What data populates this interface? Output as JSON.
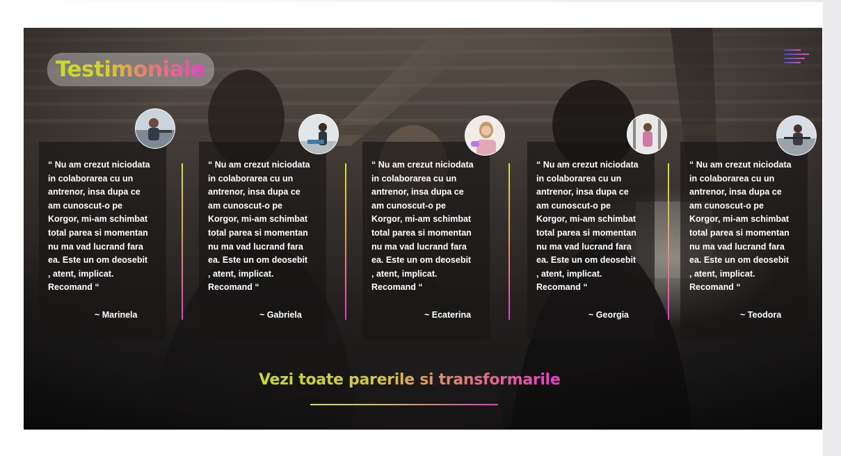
{
  "section": {
    "title": "Testimoniale",
    "menu_icon": "hamburger-menu-icon",
    "cta_label": "Vezi toate parerile si transformarile"
  },
  "colors": {
    "gradient_start": "#c7dc2a",
    "gradient_mid": "#e0a25c",
    "gradient_end": "#ec40c4",
    "card_background": "#181616",
    "menu_blue": "#3d4fd6",
    "menu_pink": "#e24bc8"
  },
  "testimonials": [
    {
      "text": "“ Nu am crezut niciodata\nin colaborarea cu un\nantrenor, insa dupa ce\nam cunoscut-o pe\n Korgor, mi-am schimbat\ntotal parea si momentan\nnu ma vad lucrand fara\nea. Este un om deosebit\n, atent, implicat.\nRecomand “",
      "author": "~ Marinela"
    },
    {
      "text": "“ Nu am crezut niciodata\nin colaborarea cu un\nantrenor, insa dupa ce\nam cunoscut-o pe\n Korgor, mi-am schimbat\ntotal parea si momentan\nnu ma vad lucrand fara\nea. Este un om deosebit\n, atent, implicat.\nRecomand “",
      "author": "~ Gabriela"
    },
    {
      "text": "“ Nu am crezut niciodata\nin colaborarea cu un\nantrenor, insa dupa ce\nam cunoscut-o pe\n Korgor, mi-am schimbat\ntotal parea si momentan\nnu ma vad lucrand fara\nea. Este un om deosebit\n, atent, implicat.\nRecomand “",
      "author": "~ Ecaterina"
    },
    {
      "text": "“ Nu am crezut niciodata\nin colaborarea cu un\nantrenor, insa dupa ce\nam cunoscut-o pe\n Korgor, mi-am schimbat\ntotal parea si momentan\nnu ma vad lucrand fara\nea. Este un om deosebit\n, atent, implicat.\nRecomand “",
      "author": "~ Georgia"
    },
    {
      "text": "“ Nu am crezut niciodata\nin colaborarea cu un\nantrenor, insa dupa ce\nam cunoscut-o pe\n Korgor, mi-am schimbat\ntotal parea si momentan\nnu ma vad lucrand fara\nea. Este un om deosebit\n, atent, implicat.\nRecomand “",
      "author": "~ Teodora"
    }
  ]
}
